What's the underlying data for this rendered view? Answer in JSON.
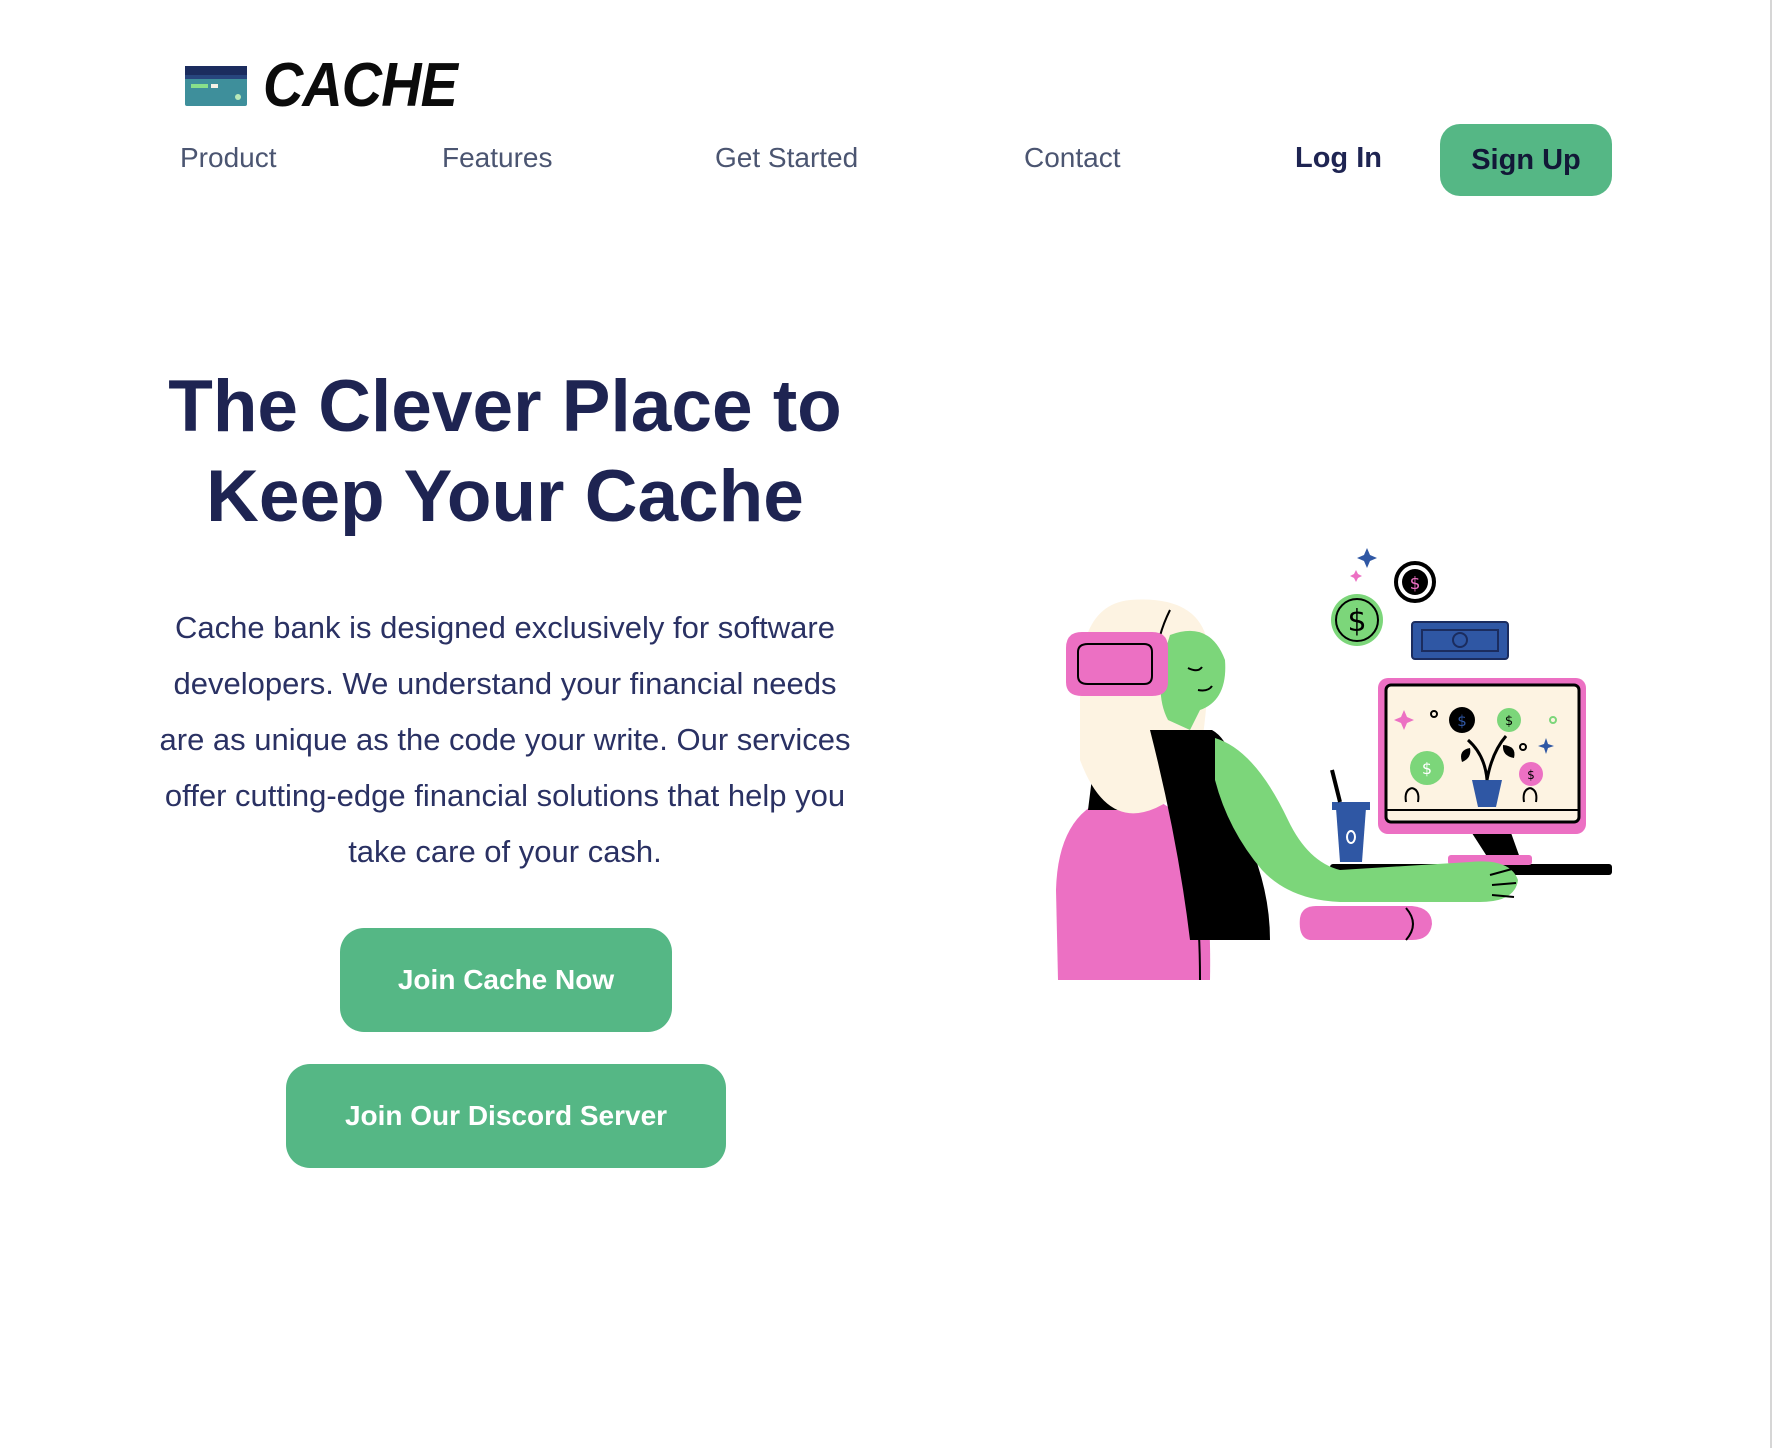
{
  "header": {
    "brand": "CACHE",
    "logo_icon": "credit-card-icon",
    "nav": [
      "Product",
      "Features",
      "Get Started",
      "Contact"
    ],
    "login_label": "Log In",
    "signup_label": "Sign Up"
  },
  "hero": {
    "title_line1": "The Clever Place to",
    "title_line2": "Keep Your Cache",
    "description": "Cache bank is designed exclusively for software developers. We understand your financial needs are as unique as the code your write. Our services offer cutting-edge financial solutions that help you take care of your cash.",
    "cta_primary": "Join Cache Now",
    "cta_secondary": "Join Our Discord Server",
    "illustration_icon": "woman-at-computer-illustration"
  },
  "colors": {
    "accent_green": "#55b785",
    "navy_text": "#1e2452",
    "nav_text": "#4b5571",
    "illustration_pink": "#ec70c3",
    "illustration_green": "#7cd67a",
    "illustration_blue": "#2f57a4",
    "illustration_cream": "#fdf3e2"
  }
}
